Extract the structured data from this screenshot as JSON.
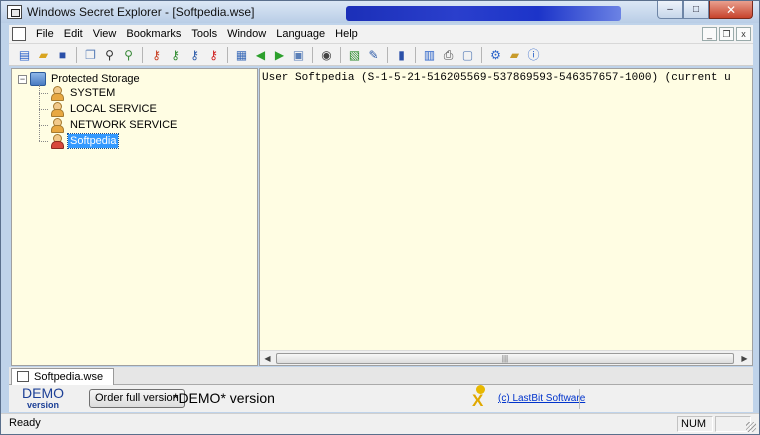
{
  "window": {
    "title": "Windows Secret Explorer - [Softpedia.wse]",
    "minimize_label": "–",
    "maximize_label": "□",
    "close_label": "✕"
  },
  "menu": {
    "items": [
      "File",
      "Edit",
      "View",
      "Bookmarks",
      "Tools",
      "Window",
      "Language",
      "Help"
    ],
    "mdi_min": "_",
    "mdi_restore": "❐",
    "mdi_close": "x"
  },
  "toolbar": {
    "icons": [
      "new-icon",
      "open-icon",
      "save-icon",
      "copy-icon",
      "search-icon",
      "search-next-icon",
      "key-icon",
      "key-add-icon",
      "key-edit-icon",
      "key-delete-icon",
      "export-icon",
      "back-icon",
      "forward-icon",
      "refresh-icon",
      "globe-icon",
      "decrypt-icon",
      "edit-icon",
      "book-icon",
      "columns-icon",
      "print-icon",
      "preview-icon",
      "settings-icon",
      "folder-icon",
      "info-icon"
    ]
  },
  "tree": {
    "root": {
      "label": "Protected Storage",
      "expander": "−"
    },
    "children": [
      {
        "label": "SYSTEM",
        "icon": "user-icon",
        "selected": false
      },
      {
        "label": "LOCAL SERVICE",
        "icon": "user-icon",
        "selected": false
      },
      {
        "label": "NETWORK SERVICE",
        "icon": "user-icon",
        "selected": false
      },
      {
        "label": "Softpedia",
        "icon": "user-current-icon",
        "selected": true
      }
    ]
  },
  "details": {
    "line": "User Softpedia (S-1-5-21-516205569-537869593-546357657-1000) (current u"
  },
  "scrollbar": {
    "left": "◀",
    "right": "▶",
    "grip": "|||"
  },
  "tabs": [
    {
      "label": "Softpedia.wse"
    }
  ],
  "demo": {
    "logo_big": "DEMO",
    "logo_small": "version",
    "order_button": "Order full version",
    "notice": "*DEMO* version",
    "vendor_link": "(c) LastBit Software"
  },
  "status": {
    "text": "Ready",
    "num": "NUM"
  }
}
